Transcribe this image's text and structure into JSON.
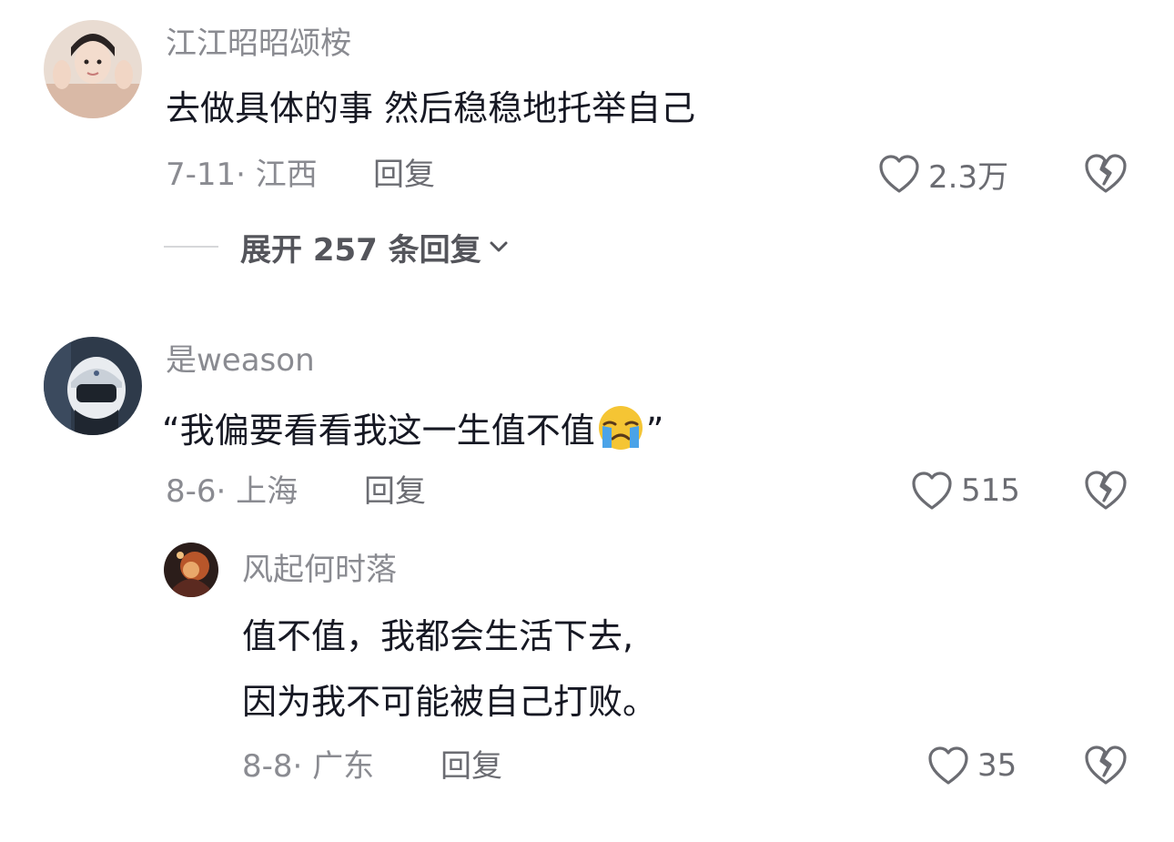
{
  "comments": [
    {
      "username": "江江昭昭颂桉",
      "text": "去做具体的事 然后稳稳地托举自己",
      "date_location": "7-11· 江西",
      "reply_label": "回复",
      "likes": "2.3万",
      "expand_label": "展开 257 条回复"
    },
    {
      "username": "是weason",
      "text_before_emoji": "“我偏要看看我这一生值不值",
      "text_after_emoji": "”",
      "emoji": "crying-emoji",
      "date_location": "8-6· 上海",
      "reply_label": "回复",
      "likes": "515"
    },
    {
      "username": "风起何时落",
      "text_line1": "值不值，我都会生活下去,",
      "text_line2": "因为我不可能被自己打败。",
      "date_location": "8-8· 广东",
      "reply_label": "回复",
      "likes": "35"
    }
  ],
  "colors": {
    "text_primary": "#161823",
    "text_secondary": "#8a8b91",
    "icon": "#6b6c72"
  }
}
